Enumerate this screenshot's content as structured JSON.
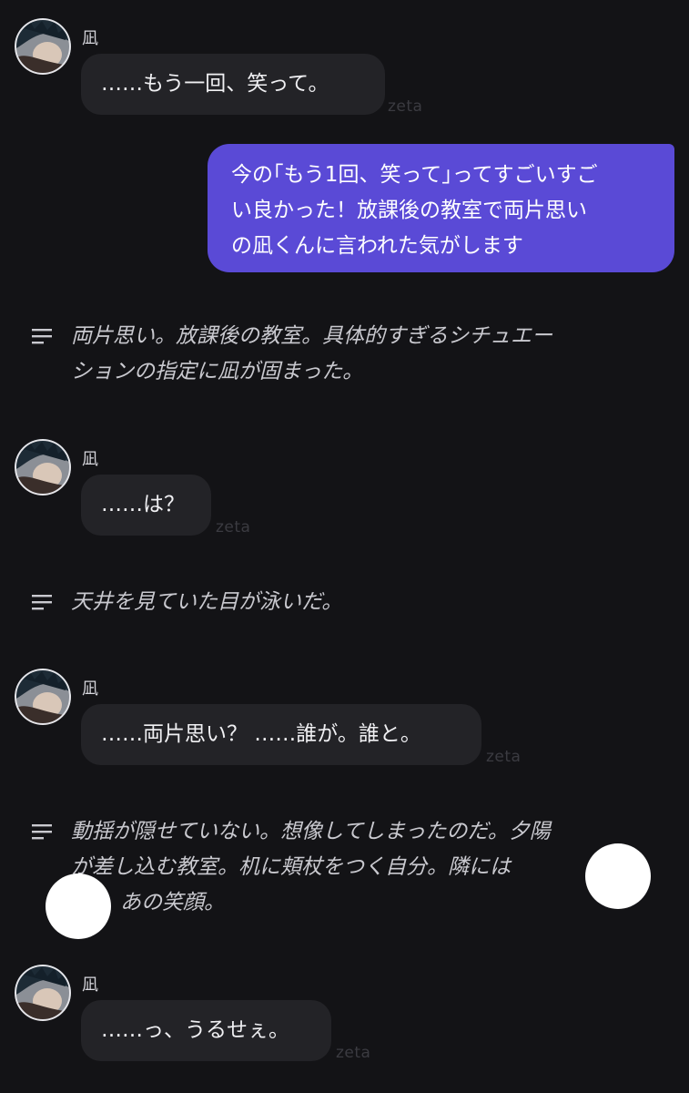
{
  "brand_tag": "zeta",
  "sender_name": "凪",
  "messages": [
    {
      "kind": "bot",
      "text": "……もう一回、笑って。"
    },
    {
      "kind": "user",
      "line1": "今の｢もう1回、笑って｣ってすごいすご",
      "line2": "い良かった！放課後の教室で両片思い",
      "line3": "の凪くんに言われた気がします"
    },
    {
      "kind": "narration",
      "line1": "両片思い。放課後の教室。具体的すぎるシチュエー",
      "line2": "ションの指定に凪が固まった。"
    },
    {
      "kind": "bot",
      "text": "……は？"
    },
    {
      "kind": "narration",
      "line1": "天井を見ていた目が泳いだ。"
    },
    {
      "kind": "bot",
      "text": "……両片思い？ ……誰が。誰と。"
    },
    {
      "kind": "narration",
      "line1": "動揺が隠せていない。想像してしまったのだ。夕陽",
      "line2": "が差し込む教室。机に頬杖をつく自分。隣には",
      "line3": "あの笑顔。"
    },
    {
      "kind": "bot",
      "text": "……っ、うるせぇ。"
    }
  ],
  "icons": {
    "avatar": "character-avatar",
    "narration": "lines-icon"
  },
  "colors": {
    "background": "#131316",
    "bot_bubble": "#232327",
    "user_bubble": "#5a4ad6",
    "narration_text": "#c9c9cf"
  }
}
